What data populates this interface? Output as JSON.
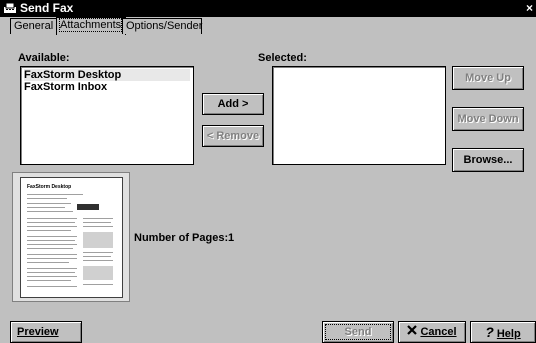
{
  "window": {
    "title": "Send Fax",
    "close_glyph": "×"
  },
  "tabs": [
    {
      "label": "General",
      "accel": "G",
      "active": false
    },
    {
      "label": "Attachments",
      "accel": "A",
      "active": true
    },
    {
      "label": "Options/Sender",
      "accel": "O",
      "active": false
    }
  ],
  "available": {
    "label": "Available:",
    "items": [
      "FaxStorm Desktop",
      "FaxStorm Inbox"
    ]
  },
  "selected": {
    "label": "Selected:",
    "items": []
  },
  "buttons": {
    "add": "Add >",
    "remove": "< Remove",
    "move_up": "Move Up",
    "move_down": "Move Down",
    "browse": "Browse..."
  },
  "preview": {
    "pages_label": "Number of Pages:",
    "pages_value": "1",
    "doc_title": "FaxStorm Desktop"
  },
  "footer": {
    "preview": "Preview",
    "send": "Send",
    "cancel": "Cancel",
    "help": "Help"
  }
}
